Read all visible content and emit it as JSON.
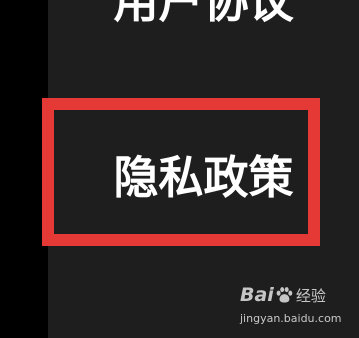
{
  "menu": {
    "items": [
      {
        "label": "用户协议"
      },
      {
        "label": "隐私政策"
      }
    ],
    "highlight_color": "#e53935"
  },
  "watermark": {
    "brand_a": "Bai",
    "brand_b": "经验",
    "url": "jingyan.baidu.com",
    "icon": "paw-icon"
  },
  "colors": {
    "background": "#000000",
    "panel": "#1e1e1e",
    "text": "#ffffff"
  }
}
